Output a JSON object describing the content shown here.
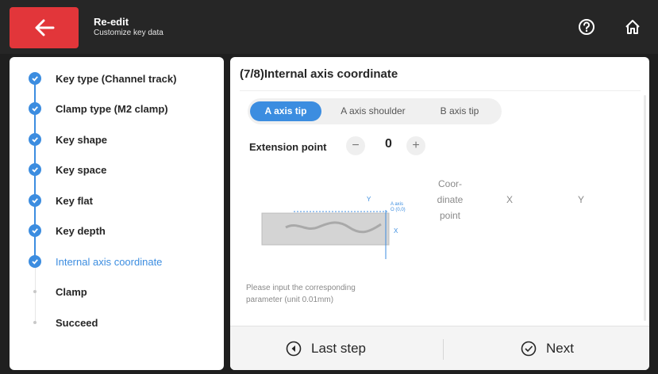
{
  "header": {
    "title": "Re-edit",
    "subtitle": "Customize key data",
    "back_icon": "arrow-left-icon",
    "help_icon": "help-circle-icon",
    "home_icon": "home-icon",
    "back_color": "#e2363a"
  },
  "steps": [
    {
      "label": "Key type (Channel track)",
      "status": "done"
    },
    {
      "label": "Clamp type (M2 clamp)",
      "status": "done"
    },
    {
      "label": "Key shape",
      "status": "done"
    },
    {
      "label": "Key space",
      "status": "done"
    },
    {
      "label": "Key flat",
      "status": "done"
    },
    {
      "label": "Key depth",
      "status": "done"
    },
    {
      "label": "Internal axis coordinate",
      "status": "current"
    },
    {
      "label": "Clamp",
      "status": "pending"
    },
    {
      "label": "Succeed",
      "status": "pending"
    }
  ],
  "main": {
    "title": "(7/8)Internal axis coordinate",
    "tabs": [
      {
        "label": "A axis tip",
        "active": true
      },
      {
        "label": "A axis shoulder",
        "active": false
      },
      {
        "label": "B axis tip",
        "active": false
      }
    ],
    "extension": {
      "label": "Extension point",
      "value": "0",
      "minus": "−",
      "plus": "+"
    },
    "diagram": {
      "y_label": "Y",
      "x_label": "X",
      "origin_line1": "A axis",
      "origin_line2": "O (0,0)"
    },
    "coords": {
      "point_header_1": "Coor-",
      "point_header_2": "dinate",
      "point_header_3": "point",
      "x_header": "X",
      "y_header": "Y"
    },
    "hint_line1": "Please input the corresponding",
    "hint_line2": "parameter (unit 0.01mm)"
  },
  "footer": {
    "last_step": "Last step",
    "next": "Next"
  },
  "accent_color": "#3c8de0"
}
